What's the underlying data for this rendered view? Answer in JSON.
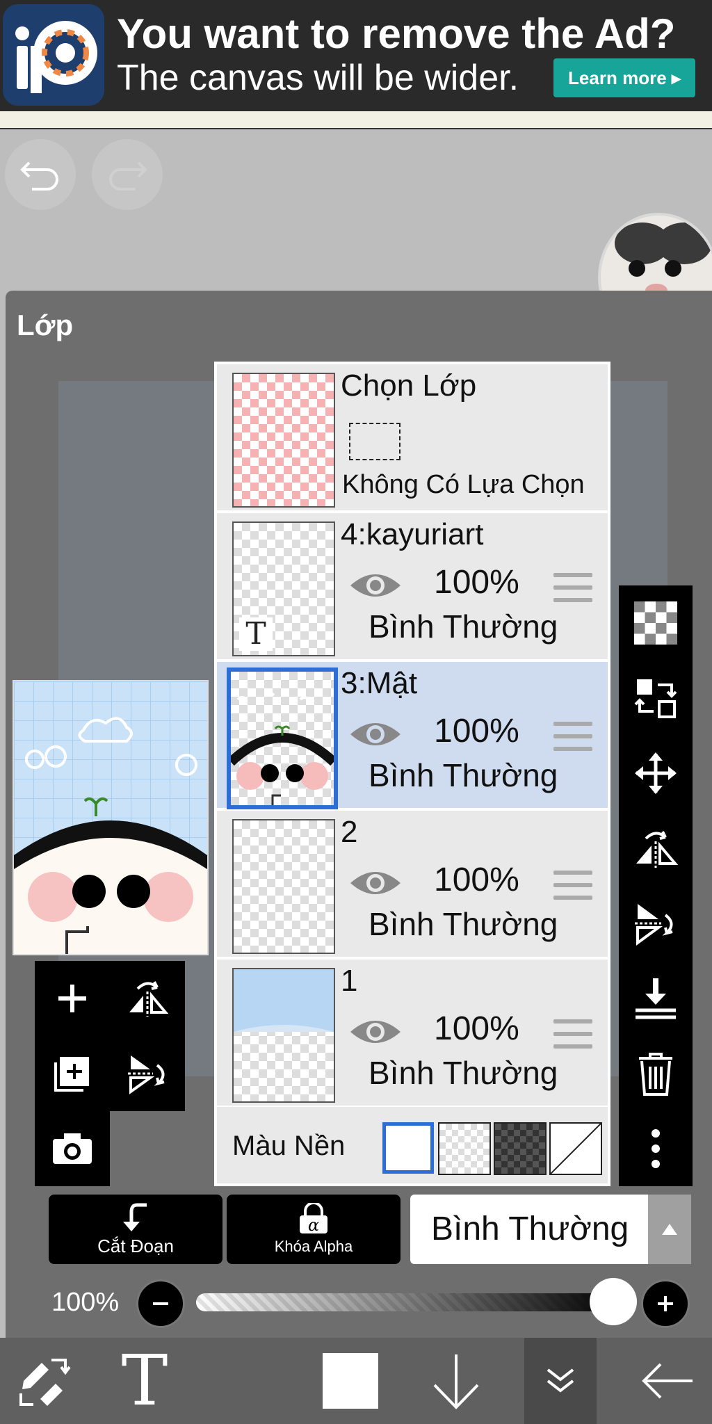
{
  "ad": {
    "title": "You want to remove the Ad?",
    "subtitle": "The canvas will be wider.",
    "button_label": "Learn more ▸"
  },
  "panel": {
    "title": "Lớp"
  },
  "selection_layer": {
    "name": "Chọn Lớp",
    "status": "Không Có Lựa Chọn"
  },
  "layers": [
    {
      "name": "4:kayuriart",
      "opacity": "100%",
      "blend": "Bình Thường",
      "selected": false
    },
    {
      "name": "3:Mật",
      "opacity": "100%",
      "blend": "Bình Thường",
      "selected": true
    },
    {
      "name": "2",
      "opacity": "100%",
      "blend": "Bình Thường",
      "selected": false
    },
    {
      "name": "1",
      "opacity": "100%",
      "blend": "Bình Thường",
      "selected": false
    }
  ],
  "background_color": {
    "label": "Màu Nền",
    "options": [
      "white",
      "transparent",
      "dark-checker",
      "custom"
    ]
  },
  "bottom_controls": {
    "clip_label": "Cắt Đoạn",
    "alpha_label": "Khóa Alpha",
    "blend_mode": "Bình Thường",
    "opacity_label": "100%",
    "opacity_value": 1.0
  },
  "colors": {
    "accent": "#2c6ed6",
    "ad_button": "#16a598",
    "selected_row": "#cfdcef"
  }
}
